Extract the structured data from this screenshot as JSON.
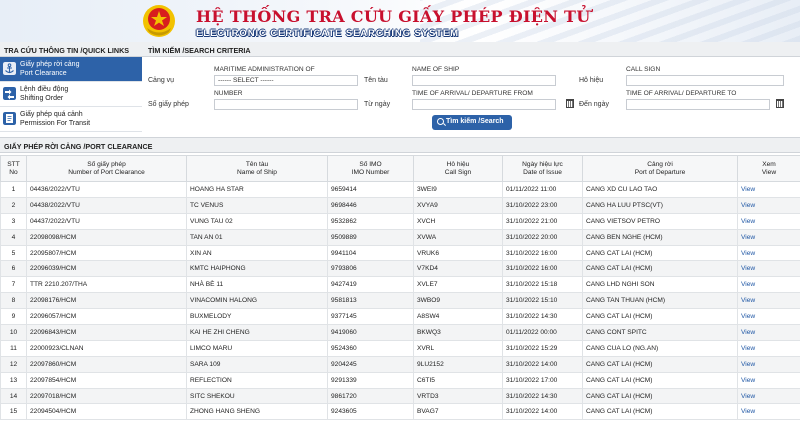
{
  "header": {
    "title_vn": "HỆ THỐNG TRA CỨU GIẤY PHÉP ĐIỆN TỬ",
    "title_en": "ELECTRONIC CERTIFICATE SEARCHING SYSTEM"
  },
  "sidebar": {
    "heading": "TRA CỨU THÔNG TIN /QUICK LINKS",
    "items": [
      {
        "vn": "Giấy phép rời cảng",
        "en": "Port Clearance",
        "icon": "anchor-icon",
        "active": true
      },
      {
        "vn": "Lệnh điều động",
        "en": "Shifting Order",
        "icon": "shifting-icon",
        "active": false
      },
      {
        "vn": "Giấy phép quá cảnh",
        "en": "Permission For Transit",
        "icon": "transit-icon",
        "active": false
      }
    ]
  },
  "criteria": {
    "heading": "TÌM KIẾM /SEARCH CRITERIA",
    "port_label": "Cảng vụ",
    "port_sub": "MARITIME ADMINISTRATION OF",
    "port_value": "------ SELECT ------",
    "ship_label": "Tên tàu",
    "ship_sub": "NAME OF SHIP",
    "callsign_label": "Hô hiệu",
    "callsign_sub": "CALL SIGN",
    "permit_label": "Số giấy phép",
    "permit_sub": "NUMBER",
    "from_label": "Từ ngày",
    "from_sub": "TIME OF ARRIVAL/ DEPARTURE FROM",
    "to_label": "Đến ngày",
    "to_sub": "TIME OF ARRIVAL/ DEPARTURE TO",
    "search_button": "Tìm kiếm /Search"
  },
  "results": {
    "heading": "GIẤY PHÉP RỜI CẢNG /PORT CLEARANCE",
    "columns": [
      {
        "vn": "STT",
        "en": "No"
      },
      {
        "vn": "Số giấy phép",
        "en": "Number of Port Clearance"
      },
      {
        "vn": "Tên tàu",
        "en": "Name of Ship"
      },
      {
        "vn": "Số IMO",
        "en": "IMO Number"
      },
      {
        "vn": "Hô hiệu",
        "en": "Call Sign"
      },
      {
        "vn": "Ngày hiệu lực",
        "en": "Date of Issue"
      },
      {
        "vn": "Cảng rời",
        "en": "Port of Departure"
      },
      {
        "vn": "Xem",
        "en": "View"
      }
    ],
    "rows": [
      [
        "1",
        "04436/2022/VTU",
        "HOANG HA STAR",
        "9659414",
        "3WEI9",
        "01/11/2022 11:00",
        "CANG XD CU LAO TAO",
        "View"
      ],
      [
        "2",
        "04438/2022/VTU",
        "TC VENUS",
        "9698446",
        "XVYA9",
        "31/10/2022 23:00",
        "CANG HA LUU PTSC(VT)",
        "View"
      ],
      [
        "3",
        "04437/2022/VTU",
        "VUNG TAU 02",
        "9532862",
        "XVCH",
        "31/10/2022 21:00",
        "CANG VIETSOV PETRO",
        "View"
      ],
      [
        "4",
        "22098098/HCM",
        "TAN AN 01",
        "9509889",
        "XVWA",
        "31/10/2022 20:00",
        "CANG BEN NGHE (HCM)",
        "View"
      ],
      [
        "5",
        "22095807/HCM",
        "XIN AN",
        "9941104",
        "VRUK6",
        "31/10/2022 16:00",
        "CANG CAT LAI (HCM)",
        "View"
      ],
      [
        "6",
        "22096039/HCM",
        "KMTC HAIPHONG",
        "9793806",
        "V7KD4",
        "31/10/2022 16:00",
        "CANG CAT LAI (HCM)",
        "View"
      ],
      [
        "7",
        "TTR 2210.207/THA",
        "NHÀ BÈ 11",
        "9427419",
        "XVLE7",
        "31/10/2022 15:18",
        "CANG LHD NGHI SON",
        "View"
      ],
      [
        "8",
        "22098176/HCM",
        "VINACOMIN HALONG",
        "9581813",
        "3WBO9",
        "31/10/2022 15:10",
        "CANG TAN THUAN (HCM)",
        "View"
      ],
      [
        "9",
        "22096057/HCM",
        "BUXMELODY",
        "9377145",
        "A8SW4",
        "31/10/2022 14:30",
        "CANG CAT LAI (HCM)",
        "View"
      ],
      [
        "10",
        "22096843/HCM",
        "KAI HE ZHI CHENG",
        "9419060",
        "BKWQ3",
        "01/11/2022 00:00",
        "CANG CONT SPITC",
        "View"
      ],
      [
        "11",
        "22000923/CLNAN",
        "LIMCO MARU",
        "9524360",
        "XVRL",
        "31/10/2022 15:29",
        "CANG CUA LO (NG.AN)",
        "View"
      ],
      [
        "12",
        "22097860/HCM",
        "SARA 109",
        "9204245",
        "9LU2152",
        "31/10/2022 14:00",
        "CANG CAT LAI (HCM)",
        "View"
      ],
      [
        "13",
        "22097854/HCM",
        "REFLECTION",
        "9291339",
        "C6TI5",
        "31/10/2022 17:00",
        "CANG CAT LAI (HCM)",
        "View"
      ],
      [
        "14",
        "22097018/HCM",
        "SITC SHEKOU",
        "9861720",
        "VRTD3",
        "31/10/2022 14:30",
        "CANG CAT LAI (HCM)",
        "View"
      ],
      [
        "15",
        "22094504/HCM",
        "ZHONG HANG SHENG",
        "9243605",
        "BVAG7",
        "31/10/2022 14:00",
        "CANG CAT LAI (HCM)",
        "View"
      ]
    ]
  },
  "colors": {
    "accent": "#2d62a8",
    "title_red": "#c8102e",
    "link": "#1f57a5",
    "emblem_red": "#d81e1e",
    "emblem_gold": "#f2c200"
  }
}
